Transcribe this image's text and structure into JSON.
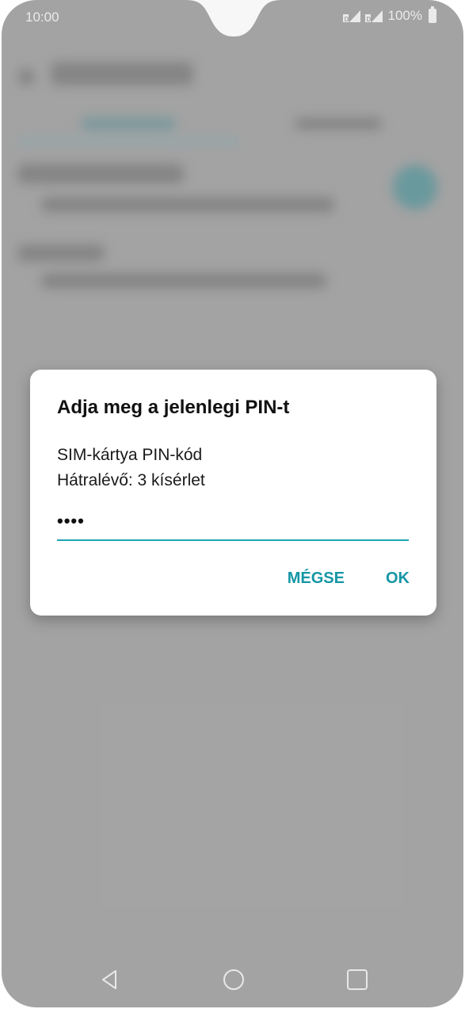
{
  "status_bar": {
    "time": "10:00",
    "battery": "100%",
    "sim_label_1": "D",
    "sim_label_2": "D"
  },
  "dialog": {
    "title": "Adja meg a jelenlegi PIN-t",
    "line1": "SIM-kártya PIN-kód",
    "line2": "Hátralévő: 3 kísérlet",
    "pin_masked": "••••",
    "cancel_label": "MÉGSE",
    "ok_label": "OK"
  },
  "nav": {
    "back_icon": "back-icon",
    "home_icon": "home-icon",
    "recents_icon": "recents-icon"
  },
  "colors": {
    "accent": "#1596a6",
    "underline": "#1ba5b3",
    "background_dim": "#a9a9a9"
  }
}
